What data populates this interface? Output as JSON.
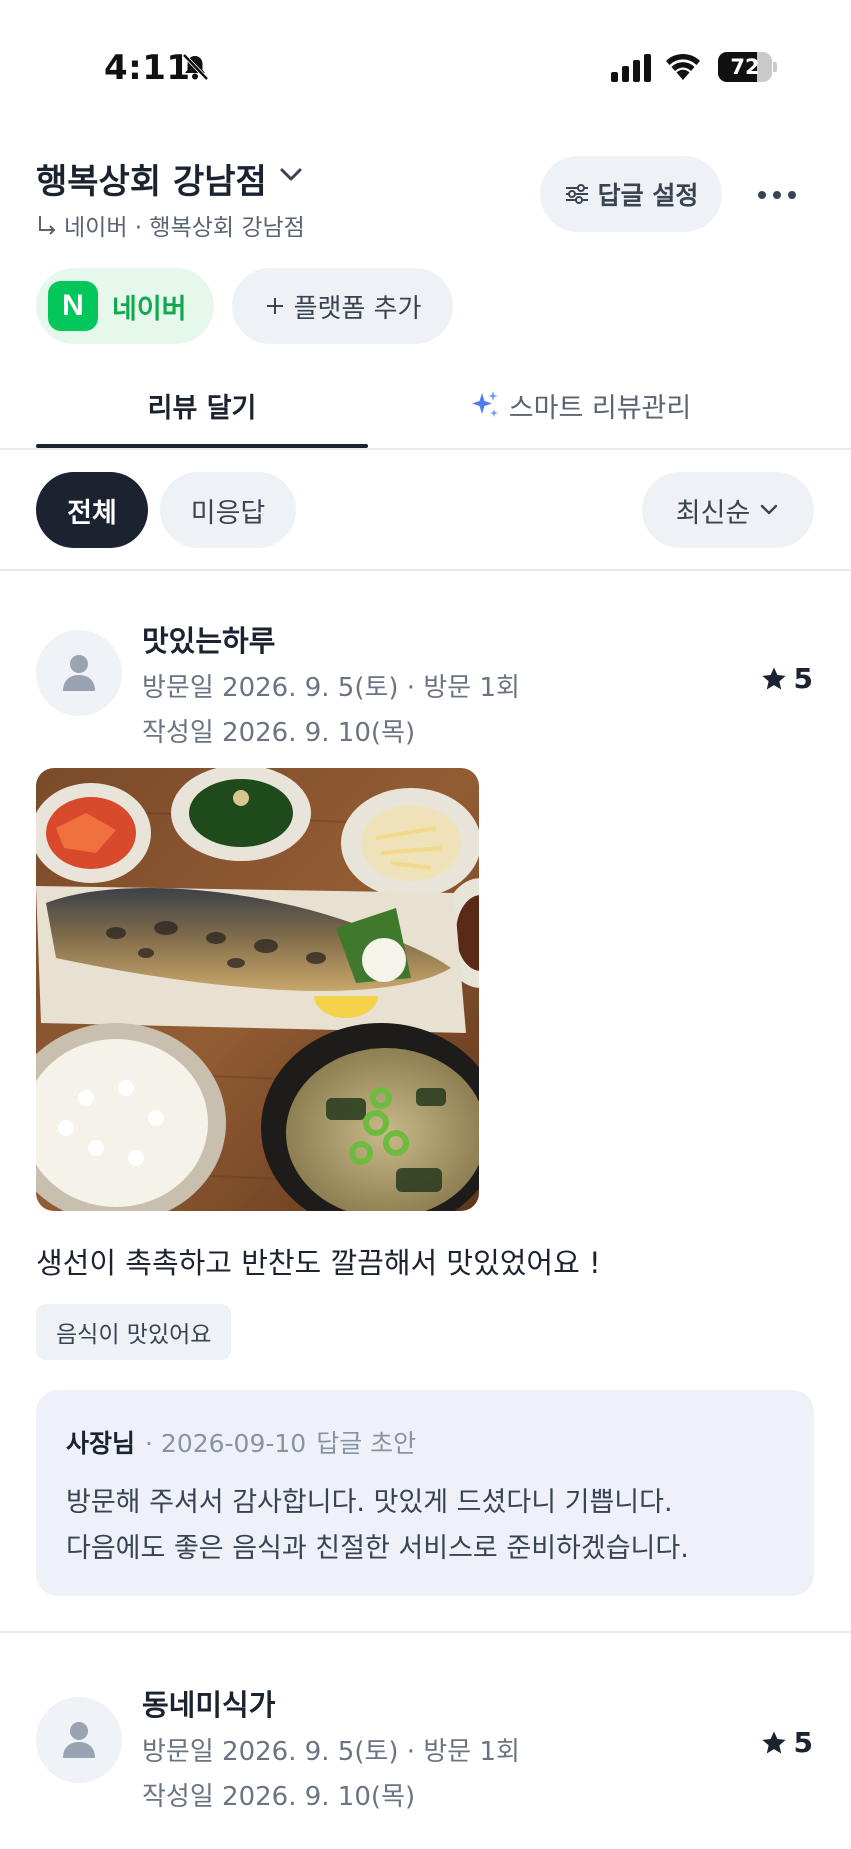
{
  "status_bar": {
    "time": "4:11",
    "battery": "72",
    "battery_level": 0.72,
    "icons": [
      "bell-slash-icon",
      "cellular-signal-icon",
      "wifi-icon",
      "battery-icon"
    ]
  },
  "header": {
    "store_name": "행복상회 강남점",
    "store_sub": "네이버 · 행복상회 강남점",
    "reply_settings_label": "답글 설정"
  },
  "platforms": {
    "naver_logo": "N",
    "naver_label": "네이버",
    "naver_color": "#03c75a",
    "add_label": "플랫폼 추가"
  },
  "tabs": [
    {
      "label": "리뷰 달기",
      "active": true
    },
    {
      "label": "스마트 리뷰관리",
      "active": false
    }
  ],
  "filters": {
    "all": "전체",
    "unanswered": "미응답",
    "sort": "최신순"
  },
  "reviews": [
    {
      "name": "맛있는하루",
      "visit": "방문일 2026. 9. 5(토) · 방문 1회",
      "written": "작성일 2026. 9. 10(목)",
      "rating": "5",
      "text": "생선이 촉촉하고 반찬도 깔끔해서 맛있었어요 !",
      "tag": "음식이 맛있어요",
      "reply": {
        "author": "사장님",
        "date": "· 2026-09-10",
        "status": "답글 초안",
        "line1": "방문해 주셔서 감사합니다. 맛있게 드셨다니 기쁩니다.",
        "line2": "다음에도 좋은 음식과 친절한 서비스로 준비하겠습니다."
      }
    },
    {
      "name": "동네미식가",
      "visit": "방문일 2026. 9. 5(토) · 방문 1회",
      "written": "작성일 2026. 9. 10(목)",
      "rating": "5"
    }
  ]
}
